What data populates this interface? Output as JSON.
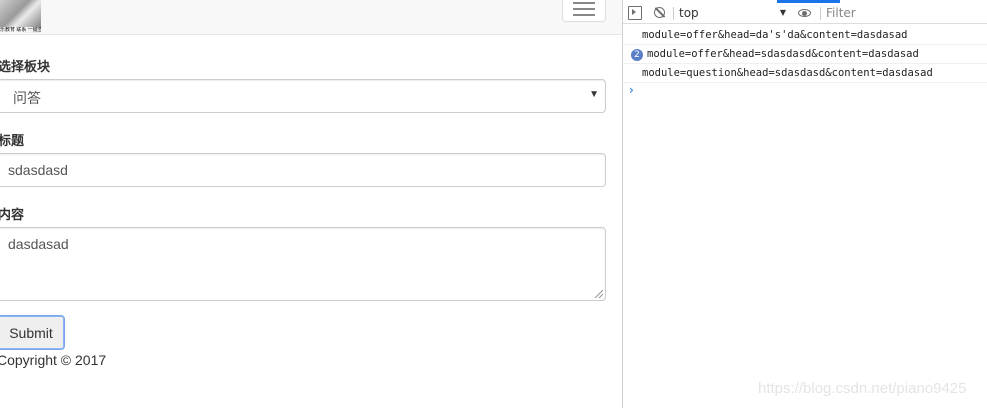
{
  "page": {
    "logo_text": "乐教育 联系 一键查",
    "form": {
      "module_label": "选择板块",
      "module_value": "问答",
      "head_label": "标题",
      "head_value": "sdasdasd",
      "content_label": "内容",
      "content_value": "dasdasad",
      "submit_label": "Submit"
    },
    "copyright": "Copyright © 2017"
  },
  "console": {
    "context": "top",
    "filter_placeholder": "Filter",
    "logs": [
      {
        "repeat": "",
        "text": "module=offer&head=da's'da&content=dasdasad"
      },
      {
        "repeat": "2",
        "text": "module=offer&head=sdasdasd&content=dasdasad"
      },
      {
        "repeat": "",
        "text": "module=question&head=sdasdasd&content=dasdasad"
      }
    ],
    "prompt": "›"
  },
  "watermark": "https://blog.csdn.net/piano9425",
  "colors": {
    "accent": "#1a73e8",
    "badge": "#5a7ec7",
    "navbar_bg": "#f8f8f8"
  },
  "icons": [
    "sidebar-toggle-icon",
    "clear-console-icon",
    "eye-icon",
    "hamburger-icon",
    "dropdown-caret-icon",
    "resize-grip-icon"
  ]
}
